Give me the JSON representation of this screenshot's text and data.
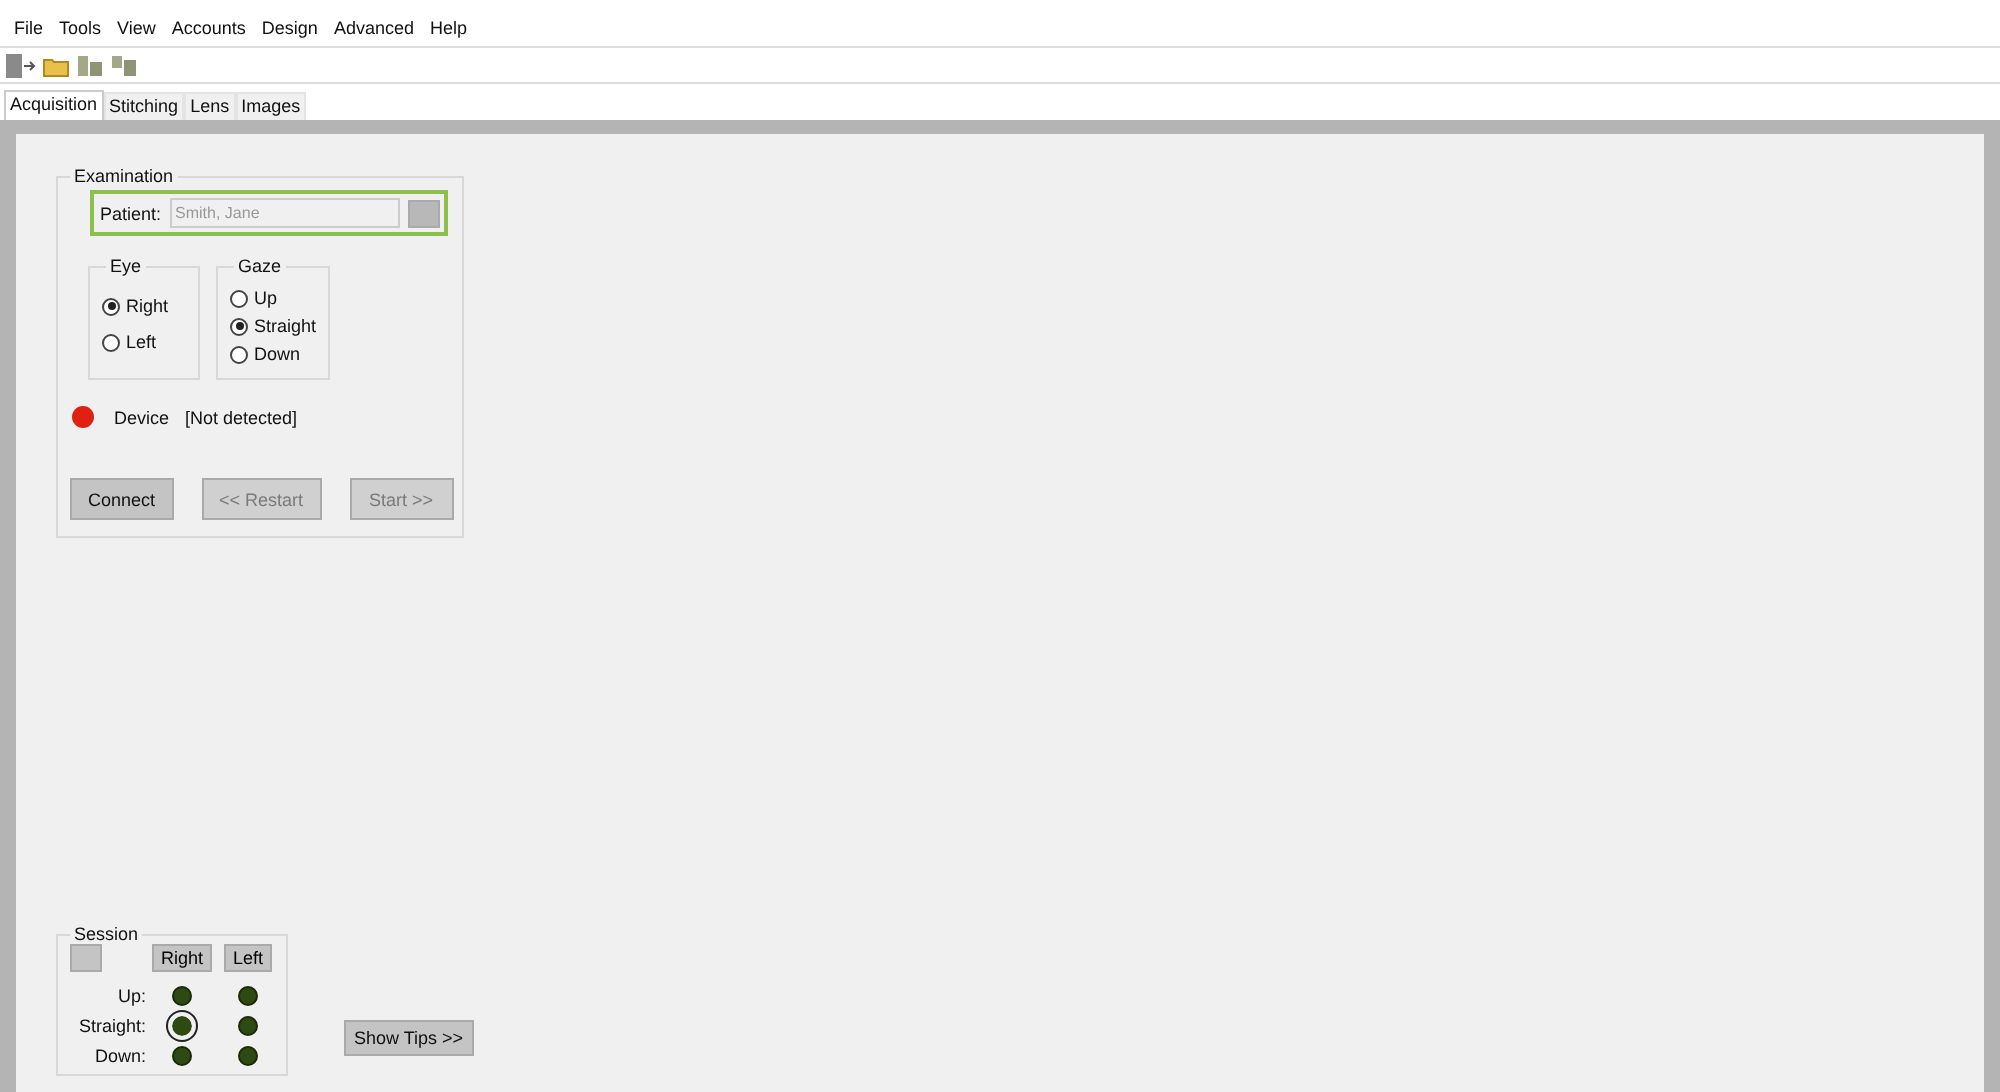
{
  "menu": [
    "File",
    "Tools",
    "View",
    "Accounts",
    "Design",
    "Advanced",
    "Help"
  ],
  "toolbar": [
    {
      "kind": "exit"
    },
    {
      "kind": "folder"
    },
    {
      "kind": "load"
    },
    {
      "kind": "unload"
    }
  ],
  "tabs": [
    {
      "label": "Acquisition",
      "selected": true
    },
    {
      "label": "Stitching",
      "selected": false
    },
    {
      "label": "Lens",
      "selected": false
    },
    {
      "label": "Images",
      "selected": false
    }
  ],
  "examination": {
    "title": "Examination",
    "patient": {
      "label": "Patient:",
      "placeholder": "Smith, Jane",
      "highlighted": true
    },
    "eye": {
      "title": "Eye",
      "options": [
        {
          "label": "Right",
          "selected": true
        },
        {
          "label": "Left",
          "selected": false
        }
      ]
    },
    "gaze": {
      "title": "Gaze",
      "options": [
        {
          "label": "Up",
          "selected": false
        },
        {
          "label": "Straight",
          "selected": true
        },
        {
          "label": "Down",
          "selected": false
        }
      ]
    },
    "device": {
      "label": "Device",
      "status": "[Not detected]",
      "color": "#e02010"
    },
    "buttons": [
      {
        "label": "Connect",
        "disabled": false
      },
      {
        "label": "<< Restart",
        "disabled": true
      },
      {
        "label": "Start >>",
        "disabled": true
      }
    ]
  },
  "session": {
    "title": "Session",
    "columns": [
      "Right",
      "Left"
    ],
    "rows": [
      {
        "label": "Up:",
        "leds": [
          {
            "selected": false
          },
          {
            "selected": false
          }
        ]
      },
      {
        "label": "Straight:",
        "leds": [
          {
            "selected": true
          },
          {
            "selected": false
          }
        ]
      },
      {
        "label": "Down:",
        "leds": [
          {
            "selected": false
          },
          {
            "selected": false
          }
        ]
      }
    ]
  },
  "show_tips": "Show Tips >>"
}
